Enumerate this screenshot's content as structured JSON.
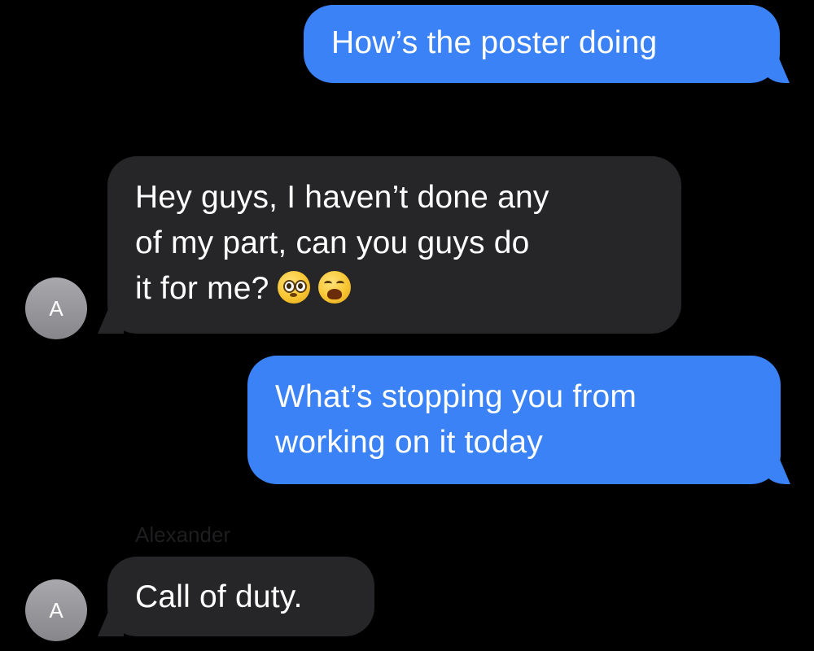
{
  "messages": [
    {
      "direction": "outgoing",
      "lines": [
        "How’s the poster doing"
      ]
    },
    {
      "direction": "incoming",
      "sender": "",
      "lines": [
        "Hey guys, I haven’t done any",
        "of my part, can you guys do",
        "it for me?"
      ],
      "emojis": [
        "pleading-face-icon",
        "weary-face-icon"
      ]
    },
    {
      "direction": "outgoing",
      "lines": [
        "What’s stopping you from",
        "working on it today"
      ]
    },
    {
      "direction": "incoming",
      "sender": "Alexander",
      "lines": [
        "Call of duty."
      ]
    }
  ],
  "avatars": [
    {
      "initial": "A"
    },
    {
      "initial": "A"
    }
  ],
  "colors": {
    "background": "#000000",
    "outgoing_bubble": "#3a82f6",
    "incoming_bubble": "#262628",
    "avatar": "#98989d",
    "text": "#ffffff"
  }
}
